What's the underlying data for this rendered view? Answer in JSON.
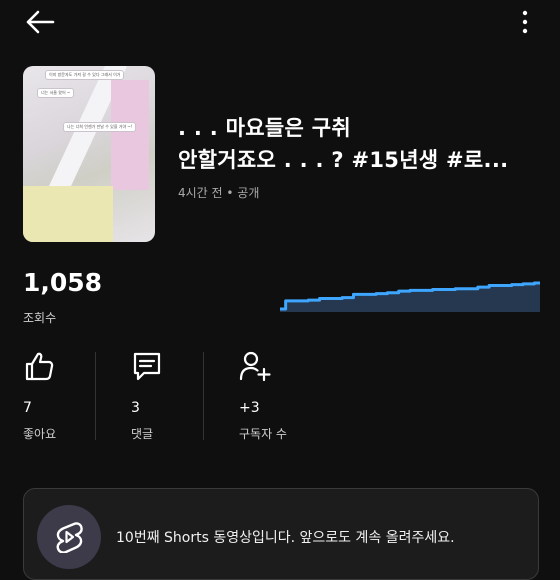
{
  "video": {
    "title_line1": ". . . 마요들은 구취",
    "title_line2": "안할거죠오 . . . ? #15년생 #로...",
    "meta": "4시간 전 • 공개"
  },
  "thumbnail": {
    "bubble1": "이미 방문자도 가져 갈 수 있다 그래서 이거",
    "bubble2": "너는 서울 왔어 ~",
    "bubble3": "나는 너희 언젠가 만날 수 있을 거야 ~!"
  },
  "views": {
    "count": "1,058",
    "label": "조회수"
  },
  "sparkline": {
    "color": "#3ea6ff",
    "values": [
      0,
      10,
      10,
      11,
      13,
      13,
      14,
      18,
      18,
      19,
      20,
      22,
      23,
      23,
      24,
      24,
      25,
      25,
      27,
      29,
      29,
      30,
      31,
      32
    ]
  },
  "stats": {
    "likes": {
      "value": "7",
      "label": "좋아요",
      "icon": "thumbs-up-icon"
    },
    "comments": {
      "value": "3",
      "label": "댓글",
      "icon": "comment-icon"
    },
    "subscribers": {
      "value": "+3",
      "label": "구독자 수",
      "icon": "person-add-icon"
    }
  },
  "milestone": {
    "text": "10번째 Shorts 동영상입니다. 앞으로도 계속 올려주세요.",
    "icon": "shorts-icon"
  },
  "colors": {
    "background": "#0f0f0f",
    "accent": "#3ea6ff"
  }
}
